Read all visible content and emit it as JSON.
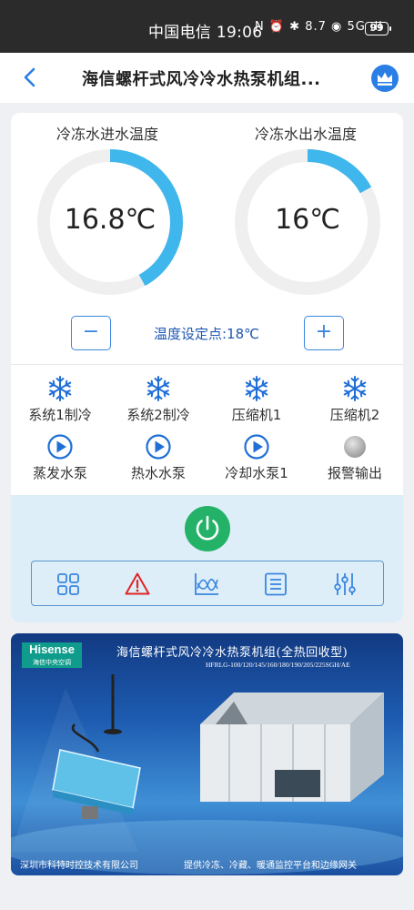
{
  "status_bar": {
    "time_text": "中国电信 19:06",
    "icons_text": "N ⏰ ✱ 8.7 ◉ 5G ıll",
    "battery": "99"
  },
  "header": {
    "title": "海信螺杆式风冷冷水热泵机组...",
    "back_icon": "chevron-left-icon",
    "crown_icon": "crown-icon"
  },
  "gauges": [
    {
      "label": "冷冻水进水温度",
      "value": "16.8℃",
      "fill": 0.42
    },
    {
      "label": "冷冻水出水温度",
      "value": "16℃",
      "fill": 0.17
    }
  ],
  "setpoint": {
    "text": "温度设定点:18℃",
    "minus": "−",
    "plus": "+"
  },
  "status": [
    {
      "label": "系统1制冷",
      "icon": "snowflake-icon"
    },
    {
      "label": "系统2制冷",
      "icon": "snowflake-icon"
    },
    {
      "label": "压缩机1",
      "icon": "snowflake-icon"
    },
    {
      "label": "压缩机2",
      "icon": "snowflake-icon"
    },
    {
      "label": "蒸发水泵",
      "icon": "play-circle-icon"
    },
    {
      "label": "热水水泵",
      "icon": "play-circle-icon"
    },
    {
      "label": "冷却水泵1",
      "icon": "play-circle-icon"
    },
    {
      "label": "报警输出",
      "icon": "alarm-off-icon"
    }
  ],
  "toolbar": [
    "grid-icon",
    "warning-icon",
    "chart-icon",
    "list-icon",
    "sliders-icon"
  ],
  "colors": {
    "accent": "#3a86e0",
    "gauge_fill": "#3fb6ec",
    "power": "#23b267",
    "warning": "#e02424"
  },
  "banner": {
    "brand": "Hisense",
    "brand_sub": "海信中央空调",
    "title": "海信螺杆式风冷冷水热泵机组(全热回收型)",
    "model": "HFRLG-100/120/145/160/180/190/205/225SGH/AE",
    "footer_left": "深圳市科特时控技术有限公司",
    "footer_right": "提供冷冻、冷藏、暖通监控平台和边缘网关"
  }
}
